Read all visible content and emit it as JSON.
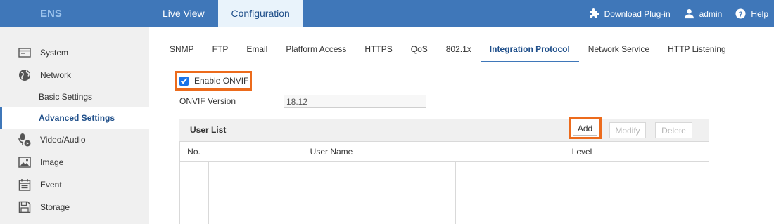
{
  "header": {
    "logo_text": "ENS",
    "tabs": [
      {
        "label": "Live View",
        "active": false
      },
      {
        "label": "Configuration",
        "active": true
      }
    ],
    "right_items": [
      {
        "label": "Download Plug-in",
        "icon": "puzzle-icon"
      },
      {
        "label": "admin",
        "icon": "user-icon"
      },
      {
        "label": "Help",
        "icon": "help-icon"
      }
    ]
  },
  "sidebar": {
    "items": [
      {
        "label": "System",
        "icon": "system-icon"
      },
      {
        "label": "Network",
        "icon": "globe-icon"
      },
      {
        "label": "Basic Settings",
        "sub": true
      },
      {
        "label": "Advanced Settings",
        "sub": true,
        "active": true
      },
      {
        "label": "Video/Audio",
        "icon": "microphone-camera-icon"
      },
      {
        "label": "Image",
        "icon": "image-icon"
      },
      {
        "label": "Event",
        "icon": "calendar-icon"
      },
      {
        "label": "Storage",
        "icon": "storage-icon"
      }
    ]
  },
  "subtabs": [
    {
      "label": "SNMP"
    },
    {
      "label": "FTP"
    },
    {
      "label": "Email"
    },
    {
      "label": "Platform Access"
    },
    {
      "label": "HTTPS"
    },
    {
      "label": "QoS"
    },
    {
      "label": "802.1x"
    },
    {
      "label": "Integration Protocol",
      "active": true
    },
    {
      "label": "Network Service"
    },
    {
      "label": "HTTP Listening"
    }
  ],
  "form": {
    "enable_onvif_label": "Enable ONVIF",
    "enable_onvif_checked": true,
    "onvif_version_label": "ONVIF Version",
    "onvif_version_value": "18.12"
  },
  "user_list": {
    "title": "User List",
    "add_label": "Add",
    "modify_label": "Modify",
    "delete_label": "Delete",
    "columns": [
      "No.",
      "User Name",
      "Level"
    ],
    "rows": []
  },
  "colors": {
    "header_bg": "#3f77b9",
    "active_tab_bg": "#e9f3fb",
    "highlight_border": "#ec6b1c",
    "sidebar_bg": "#f0f0f0"
  }
}
